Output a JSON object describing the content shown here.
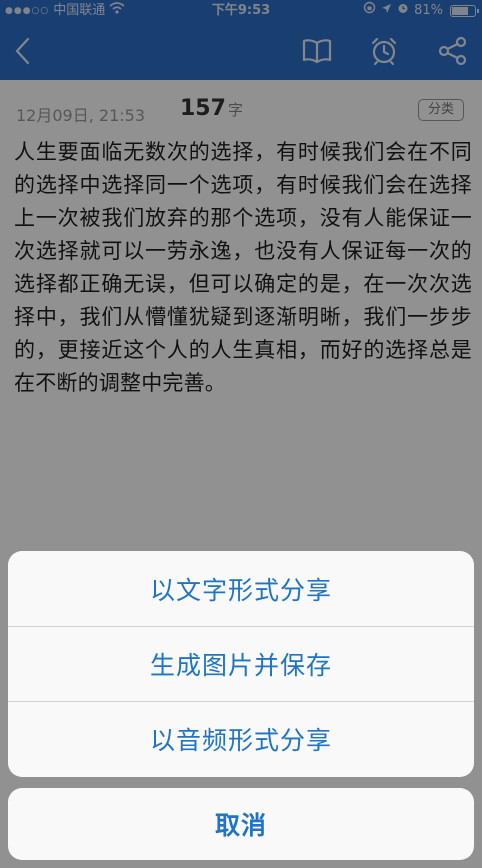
{
  "status_bar": {
    "signal": "●●●○○",
    "carrier": "中国联通",
    "time": "下午9:53",
    "battery": "81%",
    "battery_level": 0.81
  },
  "nav": {
    "icons": [
      "back-chevron-icon",
      "book-icon",
      "alarm-clock-icon",
      "share-icon"
    ]
  },
  "note": {
    "date": "12月09日, 21:53",
    "word_count": "157",
    "word_unit": "字",
    "category": "分类",
    "body": "人生要面临无数次的选择，有时候我们会在不同的选择中选择同一个选项，有时候我们会在选择上一次被我们放弃的那个选项，没有人能保证一次选择就可以一劳永逸，也没有人保证每一次的选择都正确无误，但可以确定的是，在一次次选择中，我们从懵懂犹疑到逐渐明晰，我们一步步的，更接近这个人的人生真相，而好的选择总是在不断的调整中完善。"
  },
  "action_sheet": {
    "options": [
      "以文字形式分享",
      "生成图片并保存",
      "以音频形式分享"
    ],
    "cancel": "取消"
  }
}
